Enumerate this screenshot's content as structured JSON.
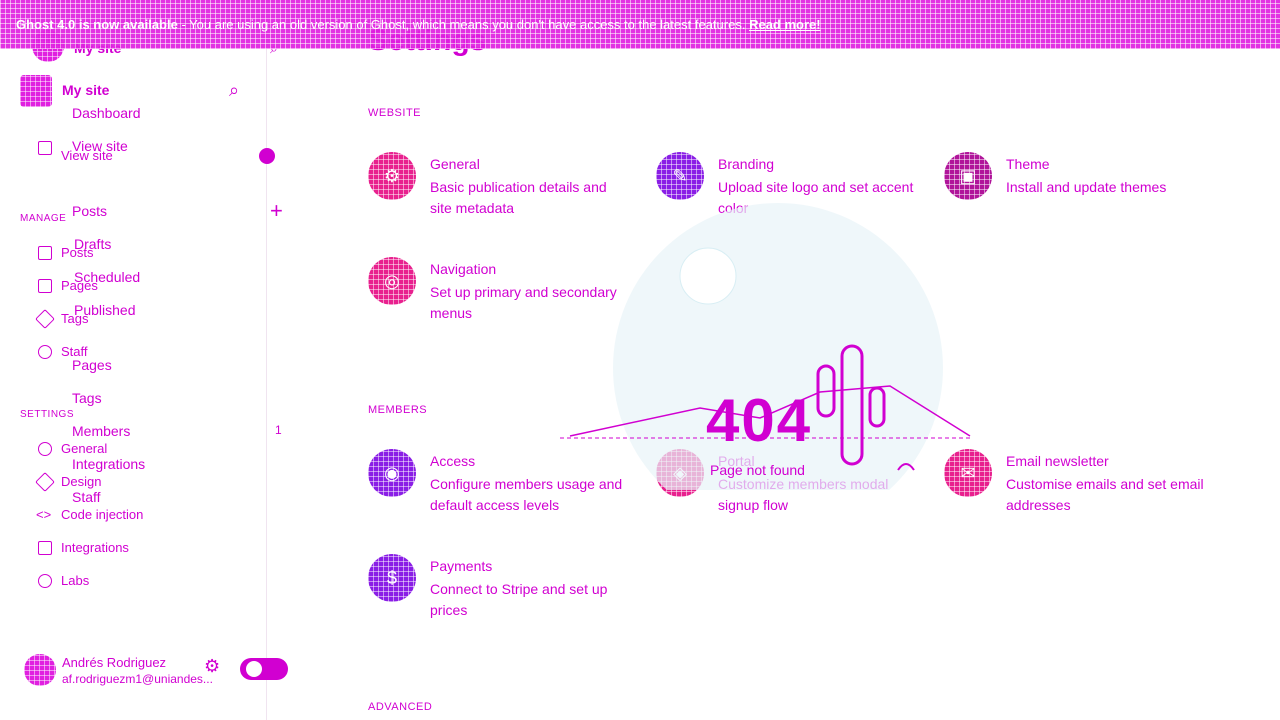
{
  "banner": {
    "bold": "Ghost 4.0 is now available",
    "text": " - You are using an old version of Ghost, which means you don't have access to the latest features.",
    "link": "Read more!"
  },
  "sidebar": {
    "site_name_top": "My site",
    "site_name": "My site",
    "ghost_nav": [
      "Dashboard",
      "View site",
      "Posts",
      "Drafts",
      "Scheduled",
      "Published",
      "Pages",
      "Tags",
      "Members",
      "Integrations",
      "Staff"
    ],
    "view_site": "View site",
    "manage_label": "MANAGE",
    "manage_items": [
      "Posts",
      "Pages",
      "Tags",
      "Staff"
    ],
    "settings_label": "SETTINGS",
    "settings_items": [
      "General",
      "Design",
      "Code injection",
      "Integrations",
      "Labs"
    ],
    "members_count": "1",
    "user_name": "Andrés Rodriguez",
    "user_email": "af.rodriguezm1@uniandes..."
  },
  "main": {
    "title": "Settings",
    "sections": {
      "website": "WEBSITE",
      "members": "MEMBERS",
      "advanced": "ADVANCED"
    },
    "cards": [
      {
        "title": "General",
        "desc": "Basic publication details and site metadata",
        "color": "#e8208e"
      },
      {
        "title": "Branding",
        "desc": "Upload site logo and set accent color",
        "color": "#8a1ee6"
      },
      {
        "title": "Theme",
        "desc": "Install and update themes",
        "color": "#b0149a"
      },
      {
        "title": "Navigation",
        "desc": "Set up primary and secondary menus",
        "color": "#e8208e"
      },
      {
        "title": "Access",
        "desc": "Configure members usage and default access levels",
        "color": "#8a1ee6"
      },
      {
        "title": "Portal",
        "desc": "Customize members modal signup flow",
        "color": "#e8208e"
      },
      {
        "title": "Email newsletter",
        "desc": "Customise emails and set email addresses",
        "color": "#e8208e"
      },
      {
        "title": "Payments",
        "desc": "Connect to Stripe and set up prices",
        "color": "#8a1ee6"
      }
    ]
  },
  "overlay": {
    "code": "404",
    "message": "Page not found"
  }
}
